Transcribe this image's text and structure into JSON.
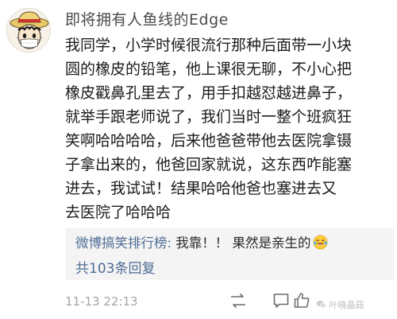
{
  "comment": {
    "username": "即将拥有人鱼线的Edge",
    "body_lines": [
      "我同学，小学时候很流行那种后面带一小块",
      "圆的橡皮的铅笔，他上课很无聊，不小心把",
      "橡皮戳鼻孔里去了，用手扣越怼越进鼻子，",
      "就举手跟老师说了，我们当时一整个班疯狂",
      "笑啊哈哈哈哈，后来他爸爸带他去医院拿镊",
      "子拿出来的，他爸回家就说，这东西咋能塞",
      "进去，我试试！结果哈哈他爸也塞进去又",
      "去医院了哈哈哈"
    ],
    "timestamp": "11-13 22:13"
  },
  "reply": {
    "author": "微博搞笑排行榜:",
    "text": " 我靠！！ 果然是亲生的",
    "emoji": "laughing-tears-icon",
    "count_label": "共103条回复"
  },
  "watermark": "叶晓晶菇",
  "colors": {
    "link_blue": "#4f6d95",
    "text": "#1c1c1c",
    "muted": "#a5a5a5",
    "reply_bg": "#f4f4f4"
  },
  "icons": [
    "repost-icon",
    "comment-icon",
    "like-icon"
  ]
}
